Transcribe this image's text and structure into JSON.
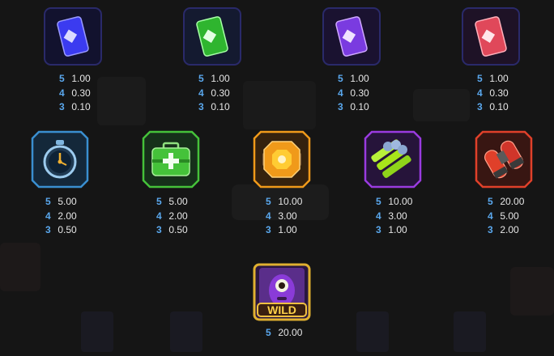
{
  "paytable": {
    "card_symbols": [
      {
        "icon": "blue-card-icon",
        "color": "#3b3bf0",
        "pays": [
          {
            "count": "5",
            "value": "1.00"
          },
          {
            "count": "4",
            "value": "0.30"
          },
          {
            "count": "3",
            "value": "0.10"
          }
        ]
      },
      {
        "icon": "green-card-icon",
        "color": "#2fb52f",
        "pays": [
          {
            "count": "5",
            "value": "1.00"
          },
          {
            "count": "4",
            "value": "0.30"
          },
          {
            "count": "3",
            "value": "0.10"
          }
        ]
      },
      {
        "icon": "purple-card-icon",
        "color": "#7a3be0",
        "pays": [
          {
            "count": "5",
            "value": "1.00"
          },
          {
            "count": "4",
            "value": "0.30"
          },
          {
            "count": "3",
            "value": "0.10"
          }
        ]
      },
      {
        "icon": "red-card-icon",
        "color": "#e0485a",
        "pays": [
          {
            "count": "5",
            "value": "1.00"
          },
          {
            "count": "4",
            "value": "0.30"
          },
          {
            "count": "3",
            "value": "0.10"
          }
        ]
      }
    ],
    "item_symbols": [
      {
        "icon": "stopwatch-icon",
        "color": "#3a8fd0",
        "pays": [
          {
            "count": "5",
            "value": "5.00"
          },
          {
            "count": "4",
            "value": "2.00"
          },
          {
            "count": "3",
            "value": "0.50"
          }
        ]
      },
      {
        "icon": "medkit-icon",
        "color": "#45c23a",
        "pays": [
          {
            "count": "5",
            "value": "5.00"
          },
          {
            "count": "4",
            "value": "2.00"
          },
          {
            "count": "3",
            "value": "0.50"
          }
        ]
      },
      {
        "icon": "power-core-icon",
        "color": "#f09a1a",
        "pays": [
          {
            "count": "5",
            "value": "10.00"
          },
          {
            "count": "4",
            "value": "3.00"
          },
          {
            "count": "3",
            "value": "1.00"
          }
        ]
      },
      {
        "icon": "energy-cells-icon",
        "color": "#9a3be0",
        "pays": [
          {
            "count": "5",
            "value": "10.00"
          },
          {
            "count": "4",
            "value": "3.00"
          },
          {
            "count": "3",
            "value": "1.00"
          }
        ]
      },
      {
        "icon": "jetpack-icon",
        "color": "#e0402a",
        "pays": [
          {
            "count": "5",
            "value": "20.00"
          },
          {
            "count": "4",
            "value": "5.00"
          },
          {
            "count": "3",
            "value": "2.00"
          }
        ]
      }
    ],
    "wild_symbol": {
      "icon": "wild-monster-icon",
      "label": "WILD",
      "color": "#8a3bd8",
      "pays": [
        {
          "count": "5",
          "value": "20.00"
        }
      ]
    }
  }
}
